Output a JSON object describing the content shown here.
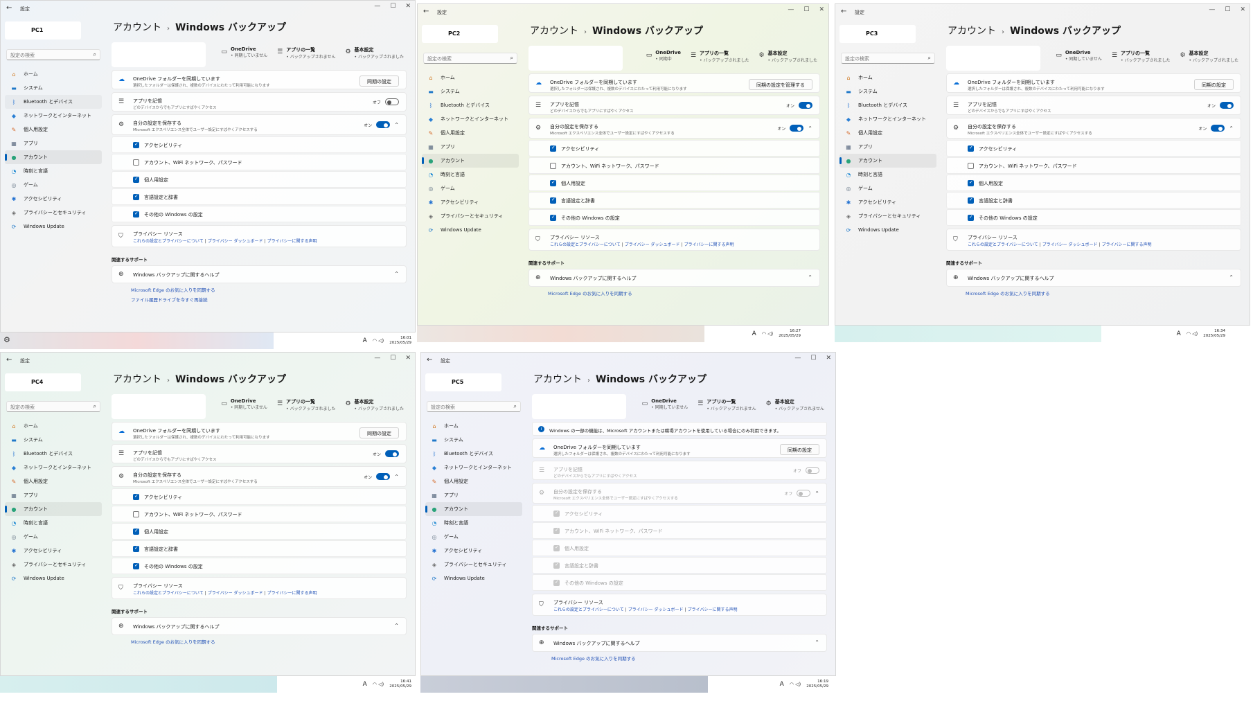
{
  "settings_app": "設定",
  "search_placeholder": "設定の検索",
  "breadcrumb": {
    "parent": "アカウント",
    "current": "Windows バックアップ"
  },
  "nav": [
    "ホーム",
    "システム",
    "Bluetooth とデバイス",
    "ネットワークとインターネット",
    "個人用設定",
    "アプリ",
    "アカウント",
    "時刻と言語",
    "ゲーム",
    "アクセシビリティ",
    "プライバシーとセキュリティ",
    "Windows Update"
  ],
  "onedrive_title": "OneDrive フォルダーを同期しています",
  "onedrive_desc": "選択したフォルダーは保護され、複数のデバイスにわたって利用可能になります",
  "apps_title": "アプリを記憶",
  "apps_desc": "どのデバイスからでもアプリにすばやくアクセス",
  "prefs_title": "自分の設定を保存する",
  "prefs_desc": "Microsoft エクスペリエンス全体でユーザー設定にすばやくアクセスする",
  "checks": [
    "アクセシビリティ",
    "アカウント、WiFi ネットワーク、パスワード",
    "個人用設定",
    "言語設定と辞書",
    "その他の Windows の設定"
  ],
  "privacy_title": "プライバシー リソース",
  "privacy_links": [
    "これらの設定とプライバシーについて",
    "プライバシー ダッシュボード",
    "プライバシーに関する声明"
  ],
  "related": "関連するサポート",
  "help": "Windows バックアップに関するヘルプ",
  "edge_link": "Microsoft Edge のお気に入りを同期する",
  "history_link": "ファイル履歴ドライブを今すぐ再接続",
  "info_msg": "Windows の一部の機能は、Microsoft アカウントまたは職場アカウントを使用している場合にのみ利用できます。",
  "toggle_on": "オン",
  "toggle_off": "オフ",
  "stat_labels": {
    "onedrive": "OneDrive",
    "apps": "アプリの一覧",
    "settings": "基本設定"
  },
  "windows": [
    {
      "id": "pc1",
      "name": "PC1",
      "onedrive_status": "同期していません",
      "apps_status": "バックアップされません",
      "settings_status": "バックアップされました",
      "onedrive_button": "同期の設定",
      "apps_on": false,
      "prefs_on": true,
      "checked": [
        true,
        false,
        true,
        true,
        true
      ],
      "time": "16:01",
      "date": "2025/05/29"
    },
    {
      "id": "pc2",
      "name": "PC2",
      "onedrive_status": "同期中",
      "apps_status": "バックアップされました",
      "settings_status": "バックアップされました",
      "onedrive_button": "同期の設定を管理する",
      "apps_on": true,
      "prefs_on": true,
      "checked": [
        true,
        false,
        true,
        true,
        true
      ],
      "time": "16:27",
      "date": "2025/05/29"
    },
    {
      "id": "pc3",
      "name": "PC3",
      "onedrive_status": "同期していません",
      "apps_status": "バックアップされました",
      "settings_status": "バックアップされました",
      "onedrive_button": "同期の設定",
      "apps_on": true,
      "prefs_on": true,
      "checked": [
        true,
        false,
        true,
        true,
        true
      ],
      "time": "16:34",
      "date": "2025/05/29"
    },
    {
      "id": "pc4",
      "name": "PC4",
      "onedrive_status": "同期していません",
      "apps_status": "バックアップされました",
      "settings_status": "バックアップされました",
      "onedrive_button": "同期の設定",
      "apps_on": true,
      "prefs_on": true,
      "checked": [
        true,
        false,
        true,
        true,
        true
      ],
      "time": "16:41",
      "date": "2025/05/29"
    },
    {
      "id": "pc5",
      "name": "PC5",
      "onedrive_status": "同期していません",
      "apps_status": "バックアップされません",
      "settings_status": "バックアップされません",
      "onedrive_button": "同期の設定",
      "apps_on": false,
      "prefs_on": false,
      "checked": [
        true,
        true,
        true,
        true,
        true
      ],
      "time": "16:19",
      "date": "2025/05/29"
    }
  ]
}
